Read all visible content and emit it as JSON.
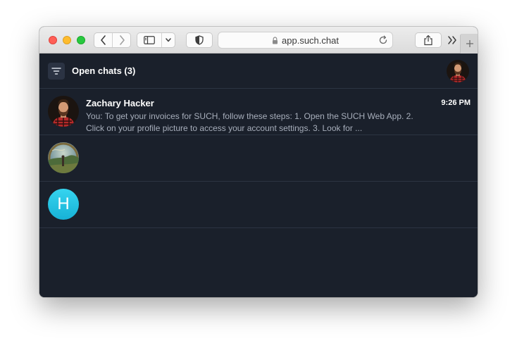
{
  "browser": {
    "url": "app.such.chat"
  },
  "header": {
    "title": "Open chats (3)"
  },
  "chats": [
    {
      "name": "Zachary Hacker",
      "time": "9:26 PM",
      "preview": "You: To get your invoices for SUCH, follow these steps: 1. Open the SUCH Web App. 2. Click on your profile picture to access your account settings. 3. Look for ..."
    },
    {
      "name": "",
      "time": "",
      "preview": ""
    },
    {
      "name": "",
      "time": "",
      "preview": "",
      "avatar_letter": "H"
    }
  ],
  "colors": {
    "app_background": "#1a202b",
    "divider": "#2c3442",
    "preview_text": "#a7aebb",
    "letter_avatar": "#22c3e3"
  }
}
